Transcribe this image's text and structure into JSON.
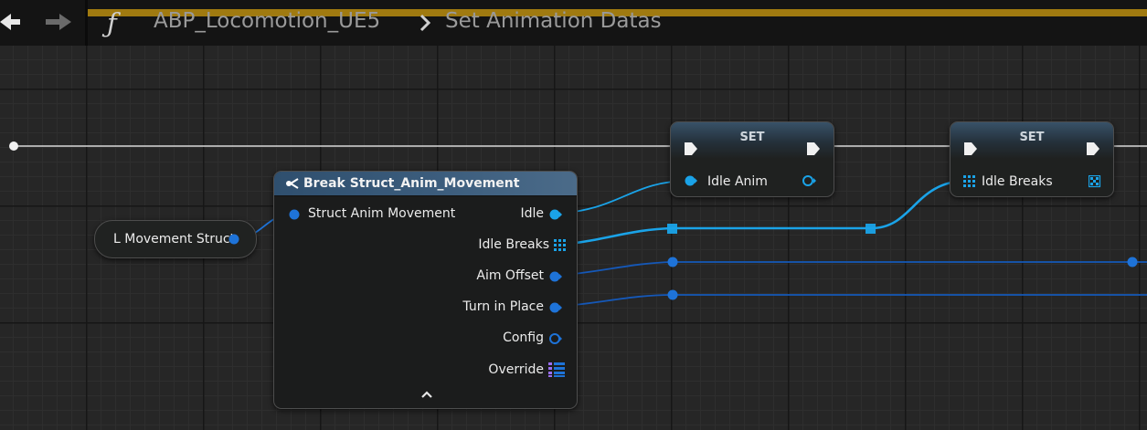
{
  "toolbar": {
    "breadcrumb": {
      "blueprint": "ABP_Locomotion_UE5",
      "function": "Set Animation Datas"
    }
  },
  "nodes": {
    "variable_get": {
      "label": "L Movement Struct"
    },
    "break_struct": {
      "title": "Break Struct_Anim_Movement",
      "input_pin": "Struct Anim Movement",
      "output_pins": [
        "Idle",
        "Idle Breaks",
        "Aim Offset",
        "Turn in Place",
        "Config",
        "Override"
      ]
    },
    "set_idle_anim": {
      "title": "SET",
      "pin": "Idle Anim"
    },
    "set_idle_breaks": {
      "title": "SET",
      "pin": "Idle Breaks"
    }
  },
  "colors": {
    "pin_struct": "#1e73d8",
    "pin_object": "#1aa3e8",
    "exec": "#e6e6e6",
    "accent_bar": "#a07a10",
    "override_pin": "#9a6ef0"
  },
  "icons": [
    "back-arrow-icon",
    "forward-arrow-icon",
    "function-icon",
    "breadcrumb-chevron-icon",
    "break-struct-icon",
    "collapse-chevron-icon"
  ]
}
